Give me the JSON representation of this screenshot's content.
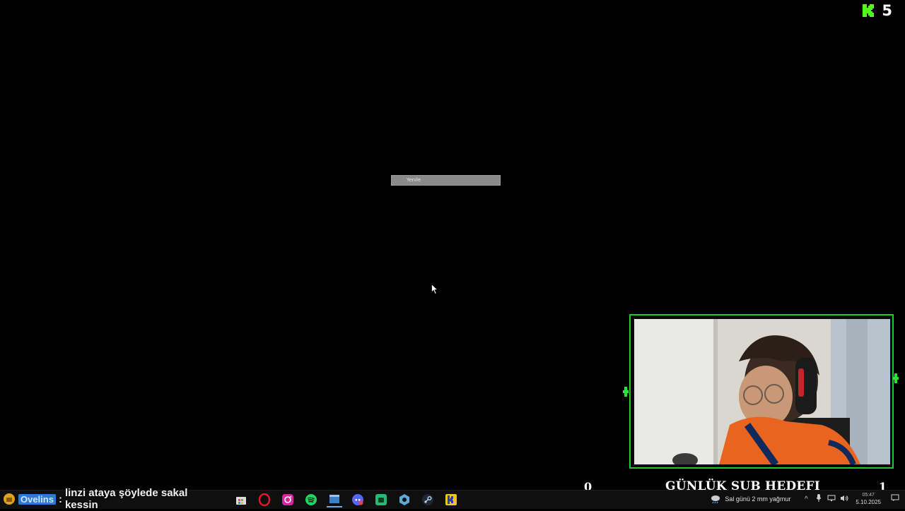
{
  "kick": {
    "icon": "kick-logo-icon",
    "viewer_count": "5",
    "brand_color": "#53fc18"
  },
  "dialog": {
    "refresh_label": "Yenile"
  },
  "overlay": {
    "frame_color": "#1fc82c",
    "sub_goal": {
      "current": "0",
      "title": "GÜNLÜK SUB HEDEFI",
      "target": "1"
    }
  },
  "chat": {
    "username": "Ovelins",
    "separator": ":",
    "message": "linzi ataya şöylede sakal kessin"
  },
  "taskbar": {
    "pinned": [
      "store-icon",
      "opera-icon",
      "instagram-icon",
      "spotify-icon",
      "window-icon",
      "discord-icon",
      "android-studio-icon",
      "settings-app-icon",
      "steam-icon",
      "kick-app-icon"
    ],
    "weather": {
      "icon": "rain-cloud-icon",
      "text": "Sal günü 2 mm yağmur"
    },
    "clock": {
      "time": "05:47",
      "date": "5.10.2025"
    }
  }
}
